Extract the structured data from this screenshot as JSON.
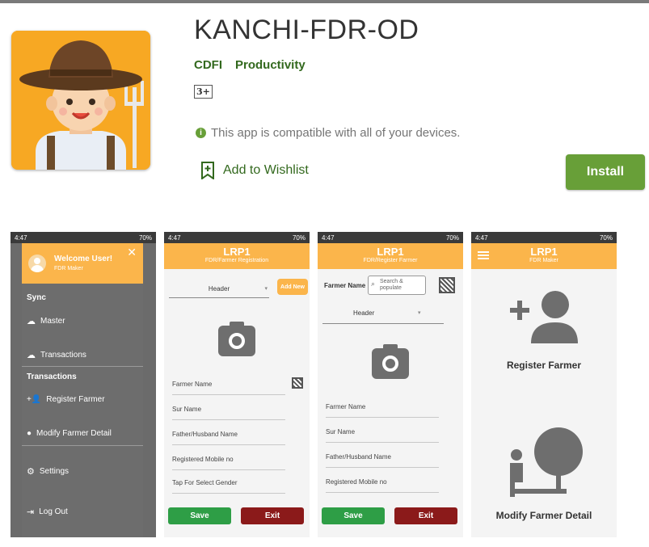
{
  "app": {
    "title": "KANCHI-FDR-OD",
    "developer": "CDFI",
    "category": "Productivity",
    "content_rating": "3+",
    "compatibility": "This app is compatible with all of your devices.",
    "wishlist_label": "Add to Wishlist",
    "install_label": "Install"
  },
  "colors": {
    "accent_green": "#689f38",
    "appbar_orange": "#fbb54b",
    "save_green": "#2e9e46",
    "exit_red": "#8b1a1a"
  },
  "screenshots": {
    "status": {
      "time": "4:47",
      "battery": "70%"
    },
    "s1": {
      "welcome": "Welcome User!",
      "role": "FDR Maker",
      "sync_header": "Sync",
      "master": "Master",
      "transactions_item": "Transactions",
      "transactions_header": "Transactions",
      "register_farmer": "Register Farmer",
      "modify_farmer": "Modify Farmer Detail",
      "settings": "Settings",
      "logout": "Log Out"
    },
    "s2": {
      "title": "LRP1",
      "subtitle": "FDR/Farmer Registration",
      "header_select": "Header",
      "add_new": "Add New",
      "fields": [
        "Farmer Name",
        "Sur Name",
        "Father/Husband Name",
        "Registered Mobile no",
        "Tap For Select Gender"
      ],
      "save": "Save",
      "exit": "Exit"
    },
    "s3": {
      "title": "LRP1",
      "subtitle": "FDR/Register Farmer",
      "farmer_name_label": "Farmer Name",
      "search_placeholder": "Search & populate",
      "header_select": "Header",
      "fields": [
        "Farmer Name",
        "Sur Name",
        "Father/Husband Name",
        "Registered Mobile no"
      ],
      "save": "Save",
      "exit": "Exit"
    },
    "s4": {
      "title": "LRP1",
      "subtitle": "FDR Maker",
      "register_label": "Register Farmer",
      "modify_label": "Modify Farmer Detail"
    }
  }
}
